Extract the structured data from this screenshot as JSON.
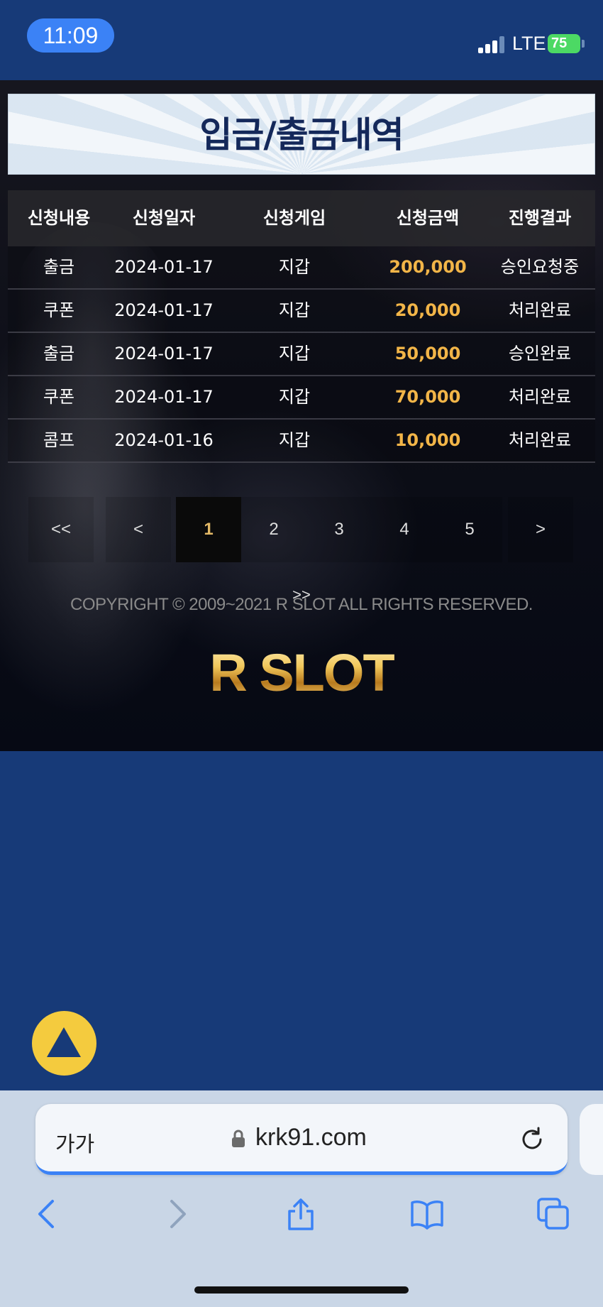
{
  "status_bar": {
    "time": "11:09",
    "network": "LTE",
    "battery": "75"
  },
  "page": {
    "title": "입금/출금내역",
    "table": {
      "headers": [
        "신청내용",
        "신청일자",
        "신청게임",
        "신청금액",
        "진행결과"
      ],
      "rows": [
        [
          "출금",
          "2024-01-17",
          "지갑",
          "200,000",
          "승인요청중"
        ],
        [
          "쿠폰",
          "2024-01-17",
          "지갑",
          "20,000",
          "처리완료"
        ],
        [
          "출금",
          "2024-01-17",
          "지갑",
          "50,000",
          "승인완료"
        ],
        [
          "쿠폰",
          "2024-01-17",
          "지갑",
          "70,000",
          "처리완료"
        ],
        [
          "콤프",
          "2024-01-16",
          "지갑",
          "10,000",
          "처리완료"
        ]
      ]
    },
    "pagination": {
      "first": "<<",
      "prev": "<",
      "pages": [
        "1",
        "2",
        "3",
        "4",
        "5"
      ],
      "current": "1",
      "next": ">",
      "last": ">>"
    },
    "copyright": "COPYRIGHT © 2009~2021 R SLOT ALL RIGHTS RESERVED.",
    "logo": "R SLOT"
  },
  "browser": {
    "text_size_button": "가가",
    "url": "krk91.com"
  },
  "colors": {
    "accent": "#f2b548",
    "background": "#173a78",
    "scroll_top": "#f4cb3e"
  },
  "icons": [
    "arrow-up-icon",
    "lock-icon",
    "reload-icon",
    "back-icon",
    "forward-icon",
    "share-icon",
    "bookmarks-icon",
    "tabs-icon"
  ]
}
